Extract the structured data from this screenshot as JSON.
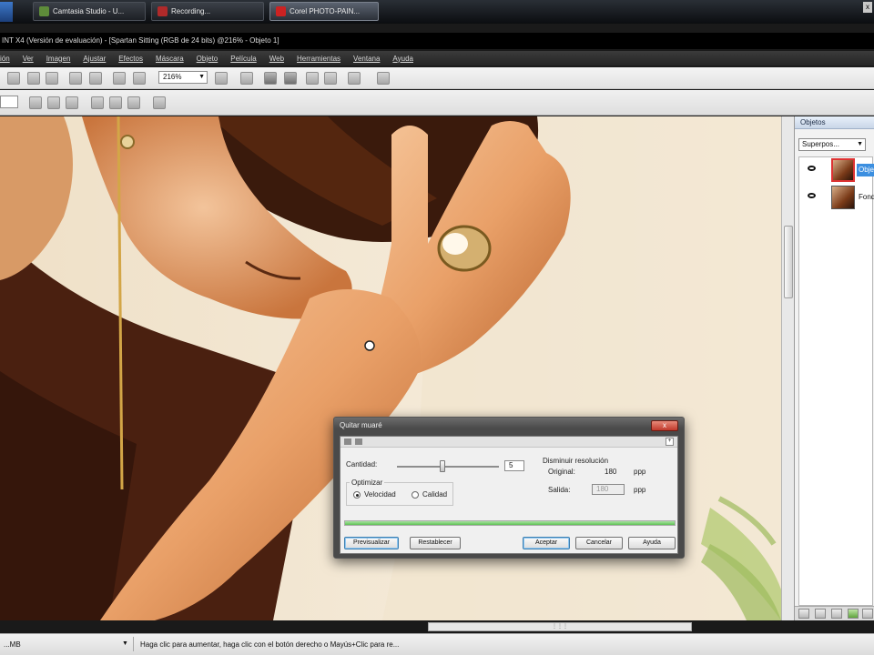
{
  "taskbar": {
    "buttons": [
      {
        "label": "Camtasia Studio - U...",
        "color": "#5e8c3a"
      },
      {
        "label": "Recording...",
        "color": "#b02a2a"
      },
      {
        "label": "Corel PHOTO-PAIN...",
        "color": "#cc2222"
      }
    ],
    "close_label": "x"
  },
  "window_title": "INT X4 (Versión de evaluación) - [Spartan Sitting (RGB de 24 bits) @216% - Objeto 1]",
  "menu": [
    "ión",
    "Ver",
    "Imagen",
    "Ajustar",
    "Efectos",
    "Máscara",
    "Objeto",
    "Película",
    "Web",
    "Herramientas",
    "Ventana",
    "Ayuda"
  ],
  "toolbar": {
    "zoom_value": "216%"
  },
  "objects_panel": {
    "title": "Objetos",
    "blend_mode": "Superpos...",
    "layers": [
      {
        "name": "Obje",
        "selected": true
      },
      {
        "name": "Fond",
        "selected": false
      }
    ]
  },
  "dialog": {
    "title": "Quitar muaré",
    "close_label": "x",
    "amount_label": "Cantidad:",
    "amount_value": "5",
    "amount_fraction": 0.45,
    "optimize_label": "Optimizar",
    "speed_label": "Velocidad",
    "quality_label": "Calidad",
    "reduce_label": "Disminuir resolución",
    "original_label": "Original:",
    "original_value": "180",
    "output_label": "Salida:",
    "output_value": "180",
    "unit": "ppp",
    "buttons": {
      "preview": "Previsualizar",
      "reset": "Restablecer",
      "ok": "Aceptar",
      "cancel": "Cancelar",
      "help": "Ayuda"
    }
  },
  "status": {
    "size": "...MB",
    "message": "Haga clic para aumentar, haga clic con el botón derecho o Mayús+Clic para re..."
  }
}
